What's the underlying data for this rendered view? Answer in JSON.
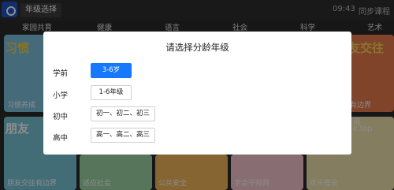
{
  "header": {
    "grade_button": "年级选择",
    "time": "09:43",
    "sync": "同步课程"
  },
  "categories": [
    "家园共育",
    "健康",
    "语言",
    "社会",
    "科学",
    "艺术"
  ],
  "background": {
    "tiles": [
      {
        "label": "习惯养成",
        "big": "习惯"
      },
      {
        "label": "有边界",
        "big": "友交往"
      },
      {
        "label": "朋友交往有边界",
        "big": "朋友"
      },
      {
        "label": "适应社会",
        "big": ""
      },
      {
        "label": "公共安全",
        "big": ""
      },
      {
        "label": "学会守规则",
        "big": ""
      },
      {
        "label": "欢乐搭安",
        "big": ""
      }
    ],
    "right_note_1": "用",
    "right_note_2": "e.top"
  },
  "dialog": {
    "title": "请选择分龄年级",
    "rows": [
      {
        "label": "学前",
        "options": [
          {
            "text": "3-6岁",
            "selected": true
          }
        ]
      },
      {
        "label": "小学",
        "options": [
          {
            "text": "1-6年级",
            "selected": false
          }
        ]
      },
      {
        "label": "初中",
        "options": [
          {
            "text": "初一、初二、初三",
            "selected": false
          }
        ]
      },
      {
        "label": "高中",
        "options": [
          {
            "text": "高一、高二、高三",
            "selected": false
          }
        ]
      }
    ]
  },
  "colors": {
    "accent": "#1677ff",
    "topbar": "#2f2f2f",
    "dialog_bg": "#ffffff"
  }
}
